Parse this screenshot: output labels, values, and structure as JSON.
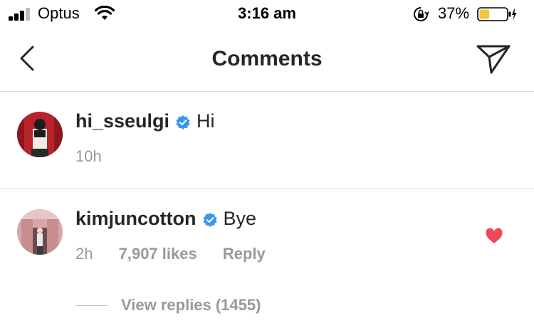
{
  "status_bar": {
    "carrier": "Optus",
    "time": "3:16 am",
    "battery_percent": "37%",
    "battery_level": 0.37,
    "icons": [
      "signal-icon",
      "wifi-icon",
      "orientation-lock-icon",
      "battery-icon",
      "charging-icon"
    ]
  },
  "nav": {
    "title": "Comments",
    "back_icon": "chevron-left-icon",
    "send_icon": "paper-plane-icon"
  },
  "comments": [
    {
      "username": "hi_sseulgi",
      "verified": true,
      "text": "Hi",
      "time": "10h"
    },
    {
      "username": "kimjuncotton",
      "verified": true,
      "text": "Bye",
      "time": "2h",
      "likes": "7,907 likes",
      "reply_label": "Reply",
      "liked": true,
      "view_replies": "View replies (1455)"
    }
  ],
  "colors": {
    "verified_blue": "#3897f0",
    "like_red": "#ed4956",
    "meta_gray": "#999999",
    "text": "#262626",
    "battery_yellow": "#f5c53b"
  }
}
